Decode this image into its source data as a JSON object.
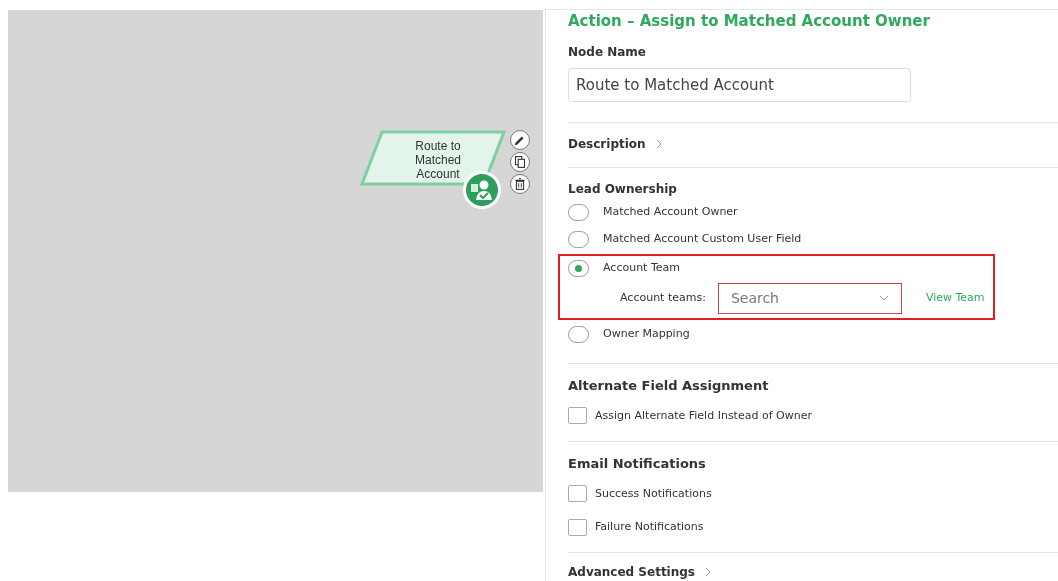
{
  "canvas": {
    "nodes": [
      {
        "label": "Route to Matched Account",
        "kind": "action"
      }
    ],
    "node_tools": [
      {
        "kind": "edit"
      },
      {
        "kind": "copy"
      },
      {
        "kind": "delete"
      }
    ]
  },
  "panel": {
    "title": "Action – Assign to Matched Account Owner",
    "node_name": {
      "label": "Node Name",
      "value": "Route to Matched Account"
    },
    "description": {
      "label": "Description",
      "expanded": false
    },
    "lead_ownership": {
      "label": "Lead Ownership",
      "options": [
        {
          "label": "Matched Account Owner",
          "selected": false
        },
        {
          "label": "Matched Account Custom User Field",
          "selected": false
        },
        {
          "label": "Account Team",
          "selected": true,
          "highlighted": true,
          "field_label": "Account teams:",
          "placeholder": "Search",
          "link": "View Team"
        },
        {
          "label": "Owner Mapping",
          "selected": false
        }
      ]
    },
    "alternate_field": {
      "label": "Alternate Field Assignment",
      "options": [
        {
          "label": "Assign Alternate Field Instead of Owner",
          "checked": false
        }
      ]
    },
    "email_notifications": {
      "label": "Email Notifications",
      "options": [
        {
          "label": "Success Notifications",
          "checked": false
        },
        {
          "label": "Failure Notifications",
          "checked": false
        }
      ]
    },
    "advanced": {
      "label": "Advanced Settings",
      "expanded": false
    }
  }
}
